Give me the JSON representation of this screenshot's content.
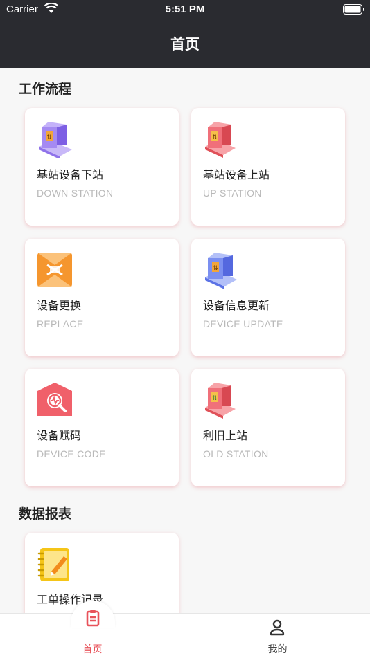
{
  "status_bar": {
    "carrier": "Carrier",
    "time": "5:51 PM"
  },
  "nav": {
    "title": "首页"
  },
  "sections": {
    "workflow": "工作流程",
    "reports": "数据报表"
  },
  "cards": {
    "down_station": {
      "title": "基站设备下站",
      "subtitle": "DOWN STATION",
      "icon": "purple-pallet-boxes-icon",
      "color": "#9b7cf0"
    },
    "up_station": {
      "title": "基站设备上站",
      "subtitle": "UP STATION",
      "icon": "red-pallet-boxes-icon",
      "color": "#f0606a"
    },
    "replace": {
      "title": "设备更换",
      "subtitle": "REPLACE",
      "icon": "orange-swap-box-icon",
      "color": "#f5962e"
    },
    "device_update": {
      "title": "设备信息更新",
      "subtitle": "DEVICE UPDATE",
      "icon": "blue-pallet-boxes-icon",
      "color": "#6f86ee"
    },
    "device_code": {
      "title": "设备赋码",
      "subtitle": "DEVICE CODE",
      "icon": "pink-search-tag-icon",
      "color": "#f0606a"
    },
    "old_station": {
      "title": "利旧上站",
      "subtitle": "OLD STATION",
      "icon": "red-pallet-boxes-icon",
      "color": "#f0606a"
    },
    "work_order_log": {
      "title": "工单操作记录",
      "icon": "yellow-notebook-pencil-icon",
      "color": "#f5c518"
    }
  },
  "tabs": {
    "home": "首页",
    "mine": "我的"
  },
  "colors": {
    "header_bg": "#2a2b30",
    "accent": "#e8525a",
    "page_bg": "#f7f7f7"
  }
}
